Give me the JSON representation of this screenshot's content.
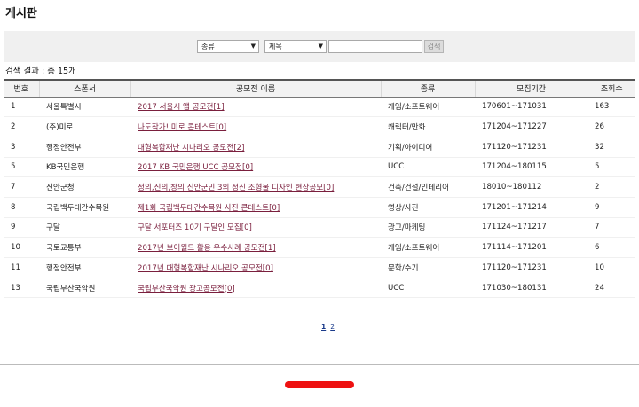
{
  "page": {
    "title": "게시판"
  },
  "search": {
    "category_select": "종류",
    "field_select": "제목",
    "input_value": "",
    "button_label": "검색"
  },
  "result_count": "검색 결과 : 총 15개",
  "table": {
    "headers": [
      "번호",
      "스폰서",
      "공모전 이름",
      "종류",
      "모집기간",
      "조회수"
    ],
    "rows": [
      {
        "no": "1",
        "sponsor": "서울특별시",
        "title": "2017 서울시 앱 공모전[1]",
        "type": "게임/소프트웨어",
        "period": "170601~171031",
        "views": "163"
      },
      {
        "no": "2",
        "sponsor": "(주)미로",
        "title": "나도작가! 미로 콘테스트[0]",
        "type": "캐릭터/만화",
        "period": "171204~171227",
        "views": "26"
      },
      {
        "no": "3",
        "sponsor": "행정안전부",
        "title": "대형복합재난 시나리오 공모전[2]",
        "type": "기획/아이디어",
        "period": "171120~171231",
        "views": "32"
      },
      {
        "no": "5",
        "sponsor": "KB국민은행",
        "title": "2017 KB 국민은행 UCC 공모전[0]",
        "type": "UCC",
        "period": "171204~180115",
        "views": "5"
      },
      {
        "no": "7",
        "sponsor": "신안군청",
        "title": "정의,신의,창의 신안군민 3의 정신 조형물 디자인 현상공모[0]",
        "type": "건축/건설/인테리어",
        "period": "18010~180112",
        "views": "2"
      },
      {
        "no": "8",
        "sponsor": "국립백두대간수목원",
        "title": "제1회 국립백두대간수목원 사진 콘테스트[0]",
        "type": "영상/사진",
        "period": "171201~171214",
        "views": "9"
      },
      {
        "no": "9",
        "sponsor": "구달",
        "title": "구달 서포터즈 10기 구달인 모집[0]",
        "type": "광고/마케팅",
        "period": "171124~171217",
        "views": "7"
      },
      {
        "no": "10",
        "sponsor": "국토교통부",
        "title": "2017년 브이월드 활용 우수사례 공모전[1]",
        "type": "게임/소프트웨어",
        "period": "171114~171201",
        "views": "6"
      },
      {
        "no": "11",
        "sponsor": "행정안전부",
        "title": "2017년 대형복합재난 시나리오 공모전[0]",
        "type": "문학/수기",
        "period": "171120~171231",
        "views": "10"
      },
      {
        "no": "13",
        "sponsor": "국립부산국악원",
        "title": "국립부산국악원 광고공모전[0]",
        "type": "UCC",
        "period": "171030~180131",
        "views": "24"
      }
    ]
  },
  "pagination": {
    "pages": [
      "1",
      "2"
    ],
    "current": "1"
  },
  "colors": {
    "link": "#7a1f3d",
    "page_link": "#1a3a8a",
    "search_bg": "#f0f0f0",
    "redaction": "#ee1111"
  }
}
